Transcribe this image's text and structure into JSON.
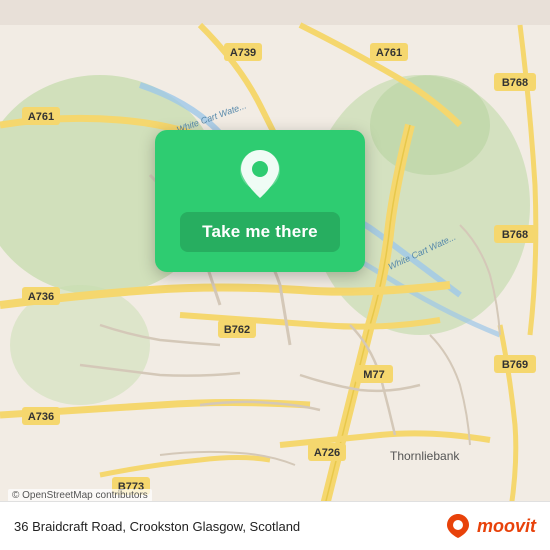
{
  "map": {
    "background_color": "#e8e0d8",
    "alt": "Map of Crookston Glasgow area showing road network"
  },
  "action_card": {
    "button_label": "Take me there",
    "pin_icon": "map-pin"
  },
  "bottom_bar": {
    "address": "36 Braidcraft Road, Crookston Glasgow, Scotland",
    "attribution": "© OpenStreetMap contributors",
    "brand_name": "moovit",
    "brand_icon": "moovit-logo"
  },
  "road_labels": [
    "A761",
    "A736",
    "A739",
    "B768",
    "B768",
    "M77",
    "B762",
    "A726",
    "B773",
    "B769",
    "A736"
  ]
}
